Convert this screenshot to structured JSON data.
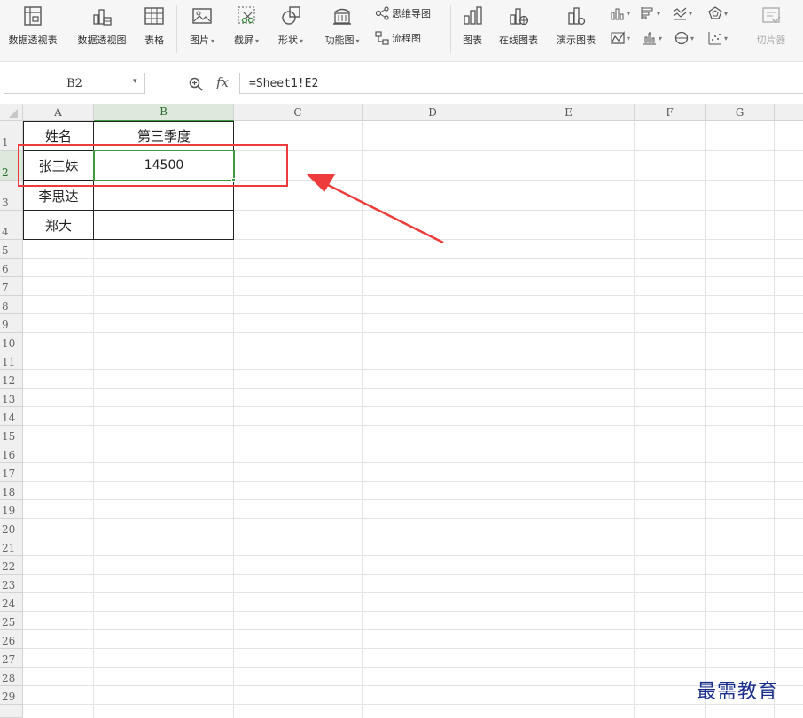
{
  "ribbon": {
    "pivot_table": "数据透视表",
    "pivot_chart": "数据透视图",
    "table": "表格",
    "picture": "图片",
    "screenshot": "截屏",
    "shapes": "形状",
    "function_chart": "功能图",
    "mind_map": "思维导图",
    "flowchart": "流程图",
    "chart": "图表",
    "online_chart": "在线图表",
    "demo_chart": "演示图表",
    "slicer": "切片器",
    "caret": "▾"
  },
  "formula_bar": {
    "name_box": "B2",
    "fx": "fx",
    "formula": "=Sheet1!E2"
  },
  "grid": {
    "columns": [
      "A",
      "B",
      "C",
      "D",
      "E",
      "F",
      "G"
    ],
    "rows": [
      "1",
      "2",
      "3",
      "4",
      "5",
      "6",
      "7",
      "8",
      "9",
      "10",
      "11",
      "12",
      "13",
      "14",
      "15",
      "16",
      "17",
      "18",
      "19",
      "20",
      "21",
      "22",
      "23",
      "24",
      "25",
      "26",
      "27",
      "28",
      "29"
    ],
    "cells": {
      "A1": "姓名",
      "B1": "第三季度",
      "A2": "张三妹",
      "B2": "14500",
      "A3": "李思达",
      "A4": "郑大"
    },
    "selected_cell": "B2"
  },
  "colors": {
    "selection_green": "#3f9a3f",
    "annotation_red": "#ee3b3b",
    "watermark_blue": "#1a2f8c"
  },
  "watermark": "最需教育"
}
